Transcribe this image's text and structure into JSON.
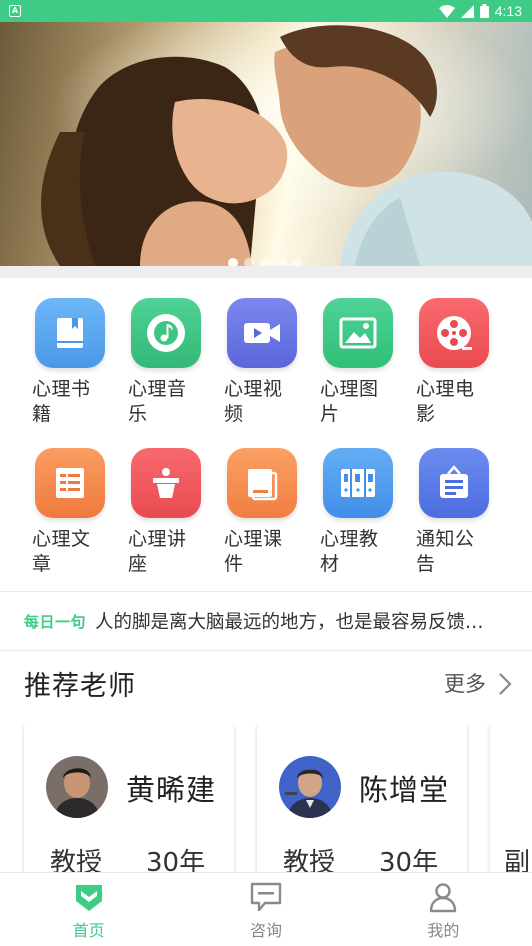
{
  "status_bar": {
    "time": "4:13",
    "notification_icon": "app-notification-icon"
  },
  "banner": {
    "slides": 5,
    "active_index": 0
  },
  "categories": [
    {
      "label": "心理书籍",
      "icon": "book-icon",
      "color": "#5aa9f2"
    },
    {
      "label": "心理音乐",
      "icon": "music-disc-icon",
      "color": "#43c58a"
    },
    {
      "label": "心理视频",
      "icon": "video-camera-icon",
      "color": "#6c78e6"
    },
    {
      "label": "心理图片",
      "icon": "picture-icon",
      "color": "#3ecb86"
    },
    {
      "label": "心理电影",
      "icon": "film-reel-icon",
      "color": "#f2555a"
    },
    {
      "label": "心理文章",
      "icon": "article-icon",
      "color": "#f68a4e"
    },
    {
      "label": "心理讲座",
      "icon": "lecture-podium-icon",
      "color": "#f05a5f"
    },
    {
      "label": "心理课件",
      "icon": "courseware-icon",
      "color": "#f7924f"
    },
    {
      "label": "心理教材",
      "icon": "textbooks-icon",
      "color": "#4f9cf0"
    },
    {
      "label": "通知公告",
      "icon": "notice-board-icon",
      "color": "#5b7be8"
    }
  ],
  "daily_quote": {
    "tag": "每日一句",
    "text": "人的脚是离大脑最远的地方，也是最容易反馈身体健康状况的地方"
  },
  "recommend": {
    "title": "推荐老师",
    "more_label": "更多",
    "teachers": [
      {
        "name": "黄晞建",
        "title": "教授",
        "years": "30年"
      },
      {
        "name": "陈增堂",
        "title": "教授",
        "years": "30年"
      },
      {
        "name": "",
        "title": "副",
        "years": ""
      }
    ]
  },
  "bottom_nav": [
    {
      "label": "首页",
      "icon": "home-shield-icon",
      "active": true
    },
    {
      "label": "咨询",
      "icon": "chat-bubble-icon",
      "active": false
    },
    {
      "label": "我的",
      "icon": "user-icon",
      "active": false
    }
  ],
  "colors": {
    "accent": "#3ecb86",
    "text": "#333333"
  }
}
